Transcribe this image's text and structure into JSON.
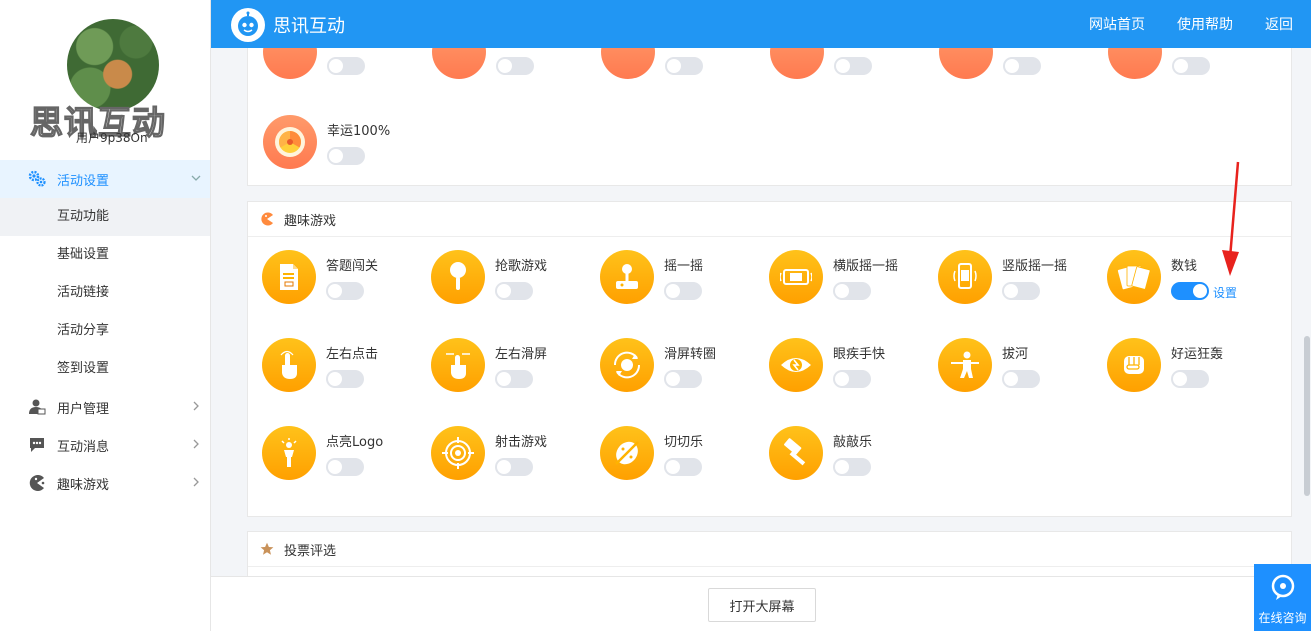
{
  "header": {
    "brand": "思讯互动",
    "nav": [
      "网站首页",
      "使用帮助",
      "返回"
    ]
  },
  "sidebar": {
    "watermark": "思讯互动",
    "username": "用户9p38On",
    "menu": [
      {
        "label": "活动设置",
        "icon": "gears-icon",
        "expanded": true
      },
      {
        "label": "用户管理",
        "icon": "user-manage-icon"
      },
      {
        "label": "互动消息",
        "icon": "chat-icon"
      },
      {
        "label": "趣味游戏",
        "icon": "pacman-icon"
      }
    ],
    "submenu": [
      "互动功能",
      "基础设置",
      "活动链接",
      "活动分享",
      "签到设置"
    ],
    "selected_submenu": "互动功能"
  },
  "top_panel": {
    "item": {
      "label": "幸运100%",
      "icon": "wheel-icon",
      "on": false
    }
  },
  "games_panel": {
    "title": "趣味游戏",
    "items": [
      {
        "label": "答题闯关",
        "icon": "document-icon",
        "on": false
      },
      {
        "label": "抢歌游戏",
        "icon": "microphone-icon",
        "on": false
      },
      {
        "label": "摇一摇",
        "icon": "joystick-icon",
        "on": false
      },
      {
        "label": "横版摇一摇",
        "icon": "phone-landscape-icon",
        "on": false
      },
      {
        "label": "竖版摇一摇",
        "icon": "phone-portrait-icon",
        "on": false
      },
      {
        "label": "数钱",
        "icon": "money-icon",
        "on": true,
        "settings": "设置"
      },
      {
        "label": "左右点击",
        "icon": "tap-hand-icon",
        "on": false
      },
      {
        "label": "左右滑屏",
        "icon": "swipe-hand-icon",
        "on": false
      },
      {
        "label": "滑屏转圈",
        "icon": "rotate-icon",
        "on": false
      },
      {
        "label": "眼疾手快",
        "icon": "eye-icon",
        "on": false
      },
      {
        "label": "拔河",
        "icon": "tug-icon",
        "on": false
      },
      {
        "label": "好运狂轰",
        "icon": "fist-icon",
        "on": false
      },
      {
        "label": "点亮Logo",
        "icon": "torch-icon",
        "on": false
      },
      {
        "label": "射击游戏",
        "icon": "target-icon",
        "on": false
      },
      {
        "label": "切切乐",
        "icon": "slice-icon",
        "on": false
      },
      {
        "label": "敲敲乐",
        "icon": "hammer-icon",
        "on": false
      }
    ]
  },
  "vote_panel": {
    "title": "投票评选"
  },
  "footer": {
    "open_button": "打开大屏幕"
  },
  "consult": {
    "label": "在线咨询"
  },
  "colors": {
    "primary": "#2196f3",
    "accent": "#1e90ff",
    "game_icon": "#ffb000",
    "annotation": "#e8221d"
  }
}
